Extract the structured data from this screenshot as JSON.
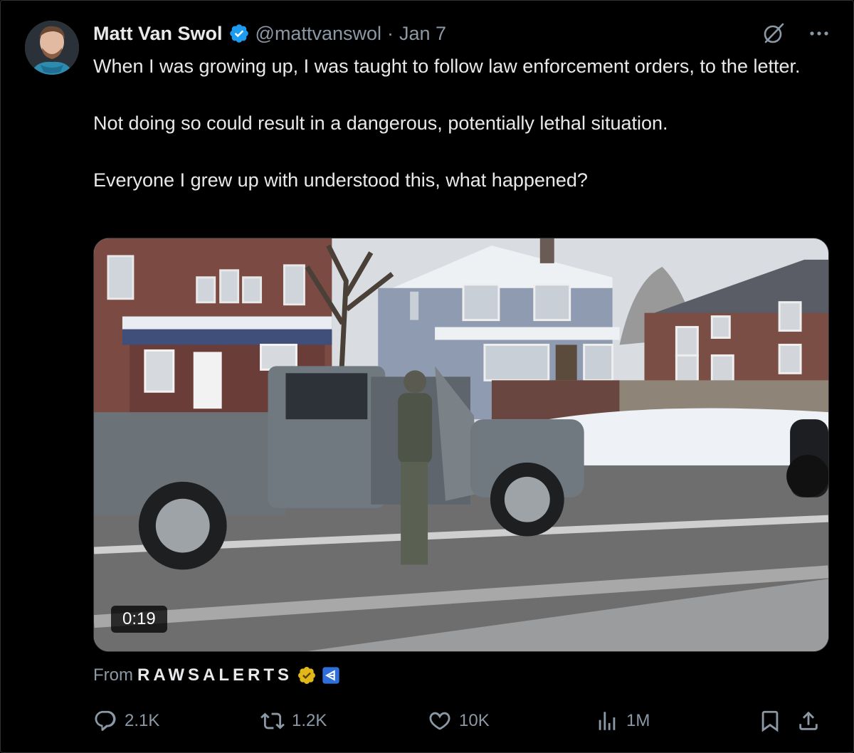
{
  "tweet": {
    "author": {
      "name": "Matt Van Swol",
      "handle": "@mattvanswol",
      "separator": "·",
      "date": "Jan 7"
    },
    "paragraphs": [
      "When I was growing up, I was taught to follow law enforcement orders, to the letter.",
      "Not doing so could result in a dangerous, potentially lethal situation.",
      "Everyone I grew up with understood this, what happened?"
    ],
    "media": {
      "type": "video",
      "duration": "0:19"
    },
    "attribution": {
      "label": "From",
      "account": "RAWSALERTS"
    },
    "stats": {
      "replies": "2.1K",
      "reposts": "1.2K",
      "likes": "10K",
      "views": "1M"
    }
  },
  "colors": {
    "background": "#000000",
    "text_primary": "#e7e9ea",
    "text_secondary": "#8b98a5",
    "verified_blue": "#1d9bf0",
    "verified_gold": "#e2b719"
  }
}
